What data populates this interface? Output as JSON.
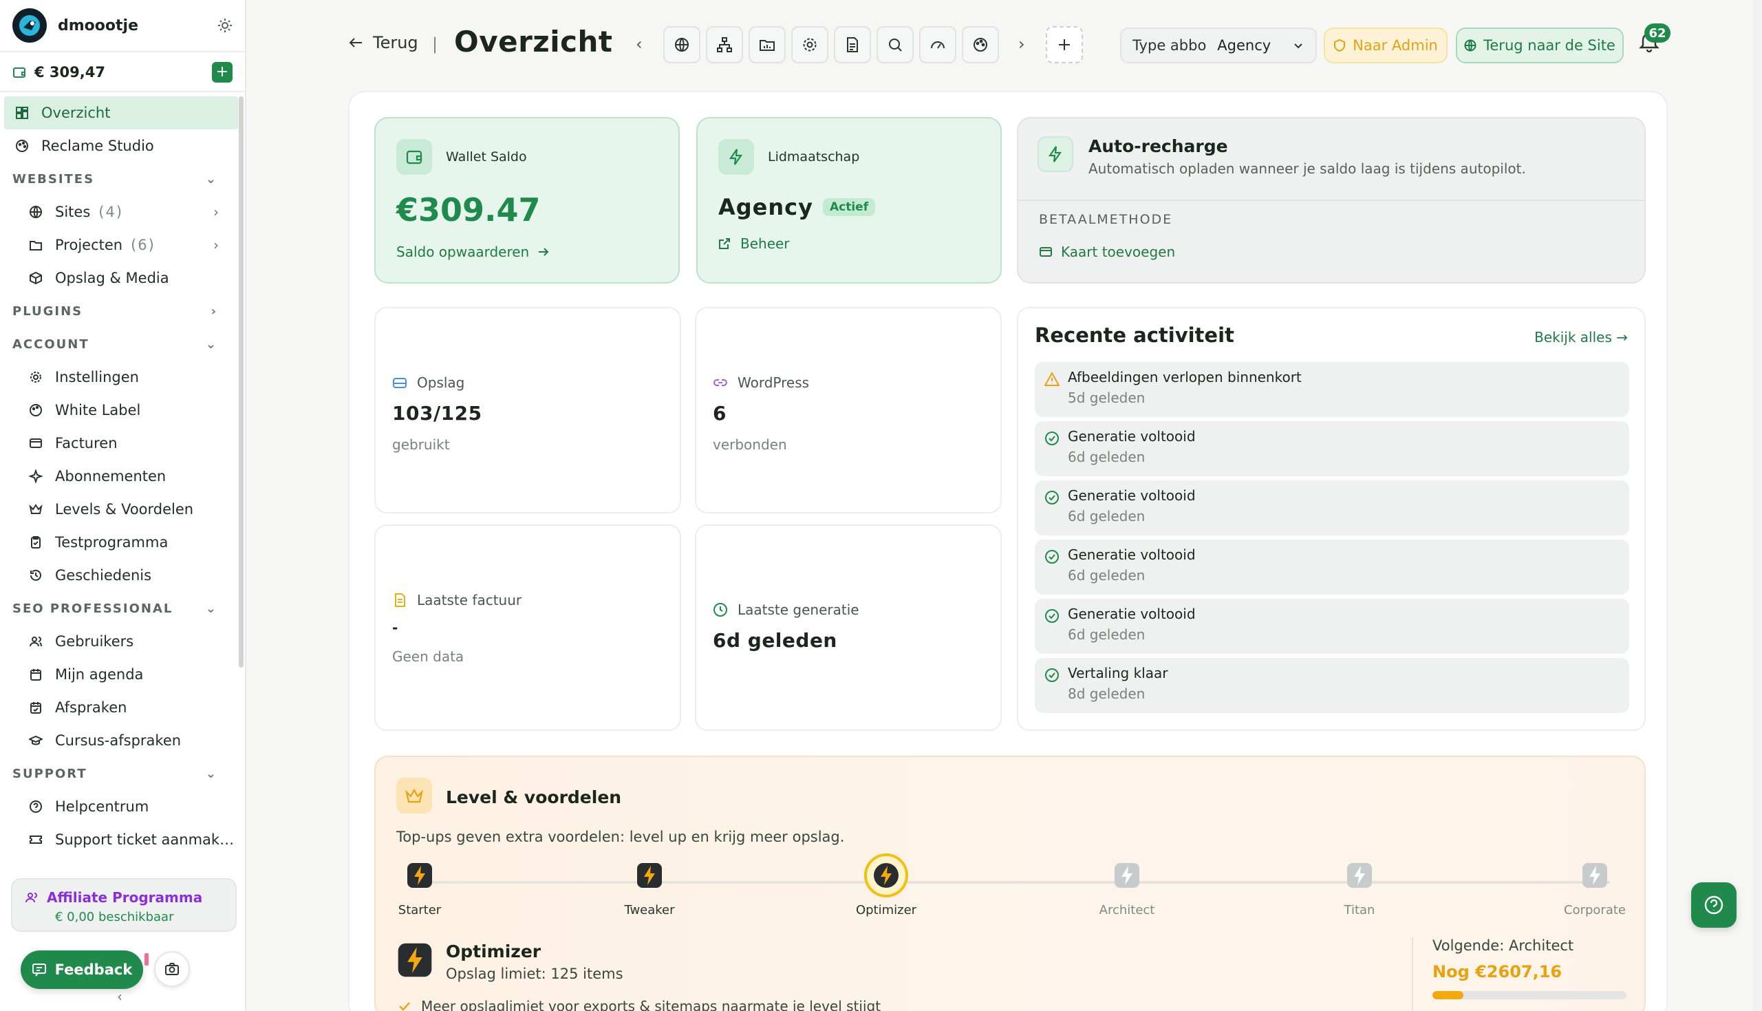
{
  "sidebar": {
    "username": "dmoootje",
    "wallet": "€ 309,47",
    "nav": {
      "overzicht": "Overzicht",
      "reclame": "Reclame Studio",
      "websites_section": "WEBSITES",
      "sites": "Sites",
      "sites_count": "(4)",
      "projecten": "Projecten",
      "projecten_count": "(6)",
      "opslag": "Opslag & Media",
      "plugins_section": "PLUGINS",
      "account_section": "ACCOUNT",
      "instellingen": "Instellingen",
      "whitelabel": "White Label",
      "facturen": "Facturen",
      "abonnementen": "Abonnementen",
      "levels": "Levels & Voordelen",
      "testprogramma": "Testprogramma",
      "geschiedenis": "Geschiedenis",
      "seo_section": "SEO PROFESSIONAL",
      "gebruikers": "Gebruikers",
      "agenda": "Mijn agenda",
      "afspraken": "Afspraken",
      "cursus": "Cursus-afspraken",
      "support_section": "SUPPORT",
      "helpcentrum": "Helpcentrum",
      "ticket": "Support ticket aanmak…"
    },
    "affiliate_title": "Affiliate Programma",
    "affiliate_sub": "€ 0,00 beschikbaar",
    "feedback": "Feedback"
  },
  "topbar": {
    "back": "Terug",
    "separator": "|",
    "title": "Overzicht",
    "type_label": "Type abbo",
    "type_value": "Agency",
    "admin": "Naar Admin",
    "site": "Terug naar de Site",
    "notifications": "62"
  },
  "cards": {
    "wallet_label": "Wallet Saldo",
    "wallet_amount": "€309.47",
    "wallet_link": "Saldo opwaarderen",
    "member_label": "Lidmaatschap",
    "member_plan": "Agency",
    "member_badge": "Actief",
    "member_link": "Beheer",
    "auto_title": "Auto-recharge",
    "auto_sub": "Automatisch opladen wanneer je saldo laag is tijdens autopilot.",
    "auto_caption": "BETAALMETHODE",
    "auto_link": "Kaart toevoegen"
  },
  "stats": {
    "opslag_label": "Opslag",
    "opslag_value": "103/125",
    "opslag_sub": "gebruikt",
    "wp_label": "WordPress",
    "wp_value": "6",
    "wp_sub": "verbonden",
    "factuur_label": "Laatste factuur",
    "factuur_value": "-",
    "factuur_sub": "Geen data",
    "gen_label": "Laatste generatie",
    "gen_value": "6d geleden"
  },
  "activity": {
    "title": "Recente activiteit",
    "view_all": "Bekijk alles →",
    "items": [
      {
        "text": "Afbeeldingen verlopen binnenkort",
        "time": "5d geleden",
        "icon": "warning-icon"
      },
      {
        "text": "Generatie voltooid",
        "time": "6d geleden",
        "icon": "check-circle-icon"
      },
      {
        "text": "Generatie voltooid",
        "time": "6d geleden",
        "icon": "check-circle-icon"
      },
      {
        "text": "Generatie voltooid",
        "time": "6d geleden",
        "icon": "check-circle-icon"
      },
      {
        "text": "Generatie voltooid",
        "time": "6d geleden",
        "icon": "check-circle-icon"
      },
      {
        "text": "Vertaling klaar",
        "time": "8d geleden",
        "icon": "check-circle-icon"
      }
    ]
  },
  "level": {
    "title": "Level & voordelen",
    "subtitle": "Top-ups geven extra voordelen: level up en krijg meer opslag.",
    "steps": [
      "Starter",
      "Tweaker",
      "Optimizer",
      "Architect",
      "Titan",
      "Corporate"
    ],
    "current_index": 2,
    "current_name": "Optimizer",
    "current_limit": "Opslag limiet: 125 items",
    "current_note": "Meer opslaglimiet voor exports & sitemaps naarmate je level stijgt",
    "next_label": "Volgende: Architect",
    "next_value": "Nog €2607,16",
    "next_progress": 0.16
  },
  "colors": {
    "primary": "#1f8a4c",
    "accent_amber": "#e8a20f",
    "affiliate": "#8b2fd6"
  }
}
